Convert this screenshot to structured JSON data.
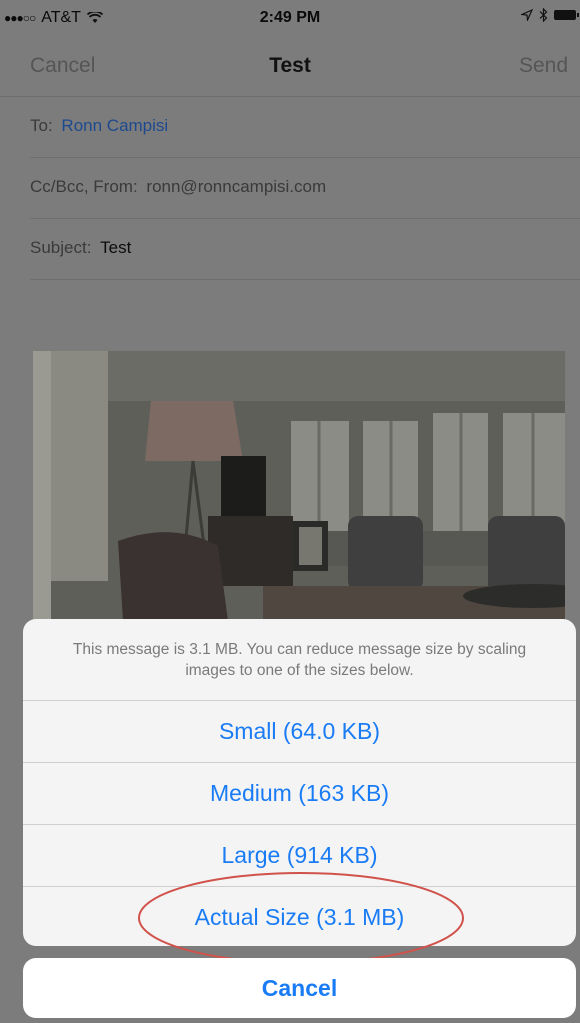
{
  "status_bar": {
    "carrier": "AT&T",
    "signal_dots": "●●●○○",
    "time": "2:49 PM"
  },
  "nav": {
    "cancel": "Cancel",
    "title": "Test",
    "send": "Send"
  },
  "fields": {
    "to_label": "To:",
    "to_value": "Ronn Campisi",
    "ccbcc_label": "Cc/Bcc, From:",
    "from_value": "ronn@ronncampisi.com",
    "subject_label": "Subject:",
    "subject_value": "Test"
  },
  "sheet": {
    "message": "This message is 3.1 MB. You can reduce message size by scaling images to one of the sizes below.",
    "options": [
      "Small (64.0 KB)",
      "Medium (163 KB)",
      "Large (914 KB)",
      "Actual Size (3.1 MB)"
    ],
    "cancel": "Cancel"
  },
  "colors": {
    "action_blue": "#1a7cf5",
    "highlight_ellipse": "#d0524a"
  }
}
